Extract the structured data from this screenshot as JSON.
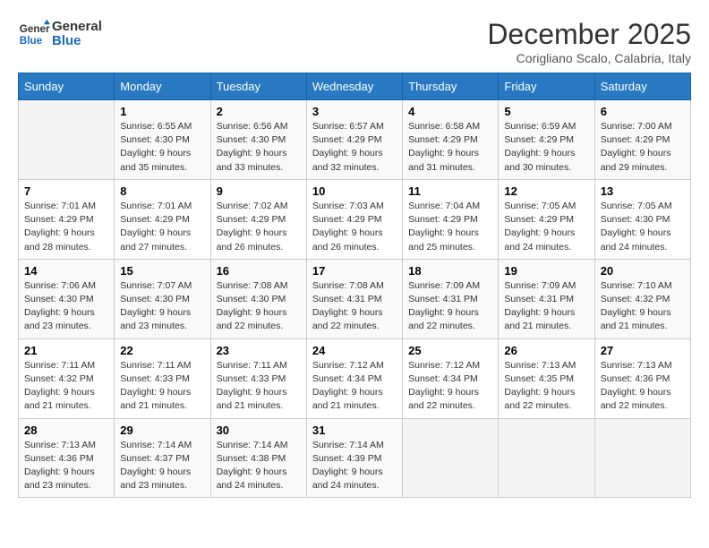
{
  "logo": {
    "line1": "General",
    "line2": "Blue"
  },
  "title": "December 2025",
  "subtitle": "Corigliano Scalo, Calabria, Italy",
  "weekdays": [
    "Sunday",
    "Monday",
    "Tuesday",
    "Wednesday",
    "Thursday",
    "Friday",
    "Saturday"
  ],
  "weeks": [
    [
      {
        "day": "",
        "info": ""
      },
      {
        "day": "1",
        "info": "Sunrise: 6:55 AM\nSunset: 4:30 PM\nDaylight: 9 hours\nand 35 minutes."
      },
      {
        "day": "2",
        "info": "Sunrise: 6:56 AM\nSunset: 4:30 PM\nDaylight: 9 hours\nand 33 minutes."
      },
      {
        "day": "3",
        "info": "Sunrise: 6:57 AM\nSunset: 4:29 PM\nDaylight: 9 hours\nand 32 minutes."
      },
      {
        "day": "4",
        "info": "Sunrise: 6:58 AM\nSunset: 4:29 PM\nDaylight: 9 hours\nand 31 minutes."
      },
      {
        "day": "5",
        "info": "Sunrise: 6:59 AM\nSunset: 4:29 PM\nDaylight: 9 hours\nand 30 minutes."
      },
      {
        "day": "6",
        "info": "Sunrise: 7:00 AM\nSunset: 4:29 PM\nDaylight: 9 hours\nand 29 minutes."
      }
    ],
    [
      {
        "day": "7",
        "info": "Sunrise: 7:01 AM\nSunset: 4:29 PM\nDaylight: 9 hours\nand 28 minutes."
      },
      {
        "day": "8",
        "info": "Sunrise: 7:01 AM\nSunset: 4:29 PM\nDaylight: 9 hours\nand 27 minutes."
      },
      {
        "day": "9",
        "info": "Sunrise: 7:02 AM\nSunset: 4:29 PM\nDaylight: 9 hours\nand 26 minutes."
      },
      {
        "day": "10",
        "info": "Sunrise: 7:03 AM\nSunset: 4:29 PM\nDaylight: 9 hours\nand 26 minutes."
      },
      {
        "day": "11",
        "info": "Sunrise: 7:04 AM\nSunset: 4:29 PM\nDaylight: 9 hours\nand 25 minutes."
      },
      {
        "day": "12",
        "info": "Sunrise: 7:05 AM\nSunset: 4:29 PM\nDaylight: 9 hours\nand 24 minutes."
      },
      {
        "day": "13",
        "info": "Sunrise: 7:05 AM\nSunset: 4:30 PM\nDaylight: 9 hours\nand 24 minutes."
      }
    ],
    [
      {
        "day": "14",
        "info": "Sunrise: 7:06 AM\nSunset: 4:30 PM\nDaylight: 9 hours\nand 23 minutes."
      },
      {
        "day": "15",
        "info": "Sunrise: 7:07 AM\nSunset: 4:30 PM\nDaylight: 9 hours\nand 23 minutes."
      },
      {
        "day": "16",
        "info": "Sunrise: 7:08 AM\nSunset: 4:30 PM\nDaylight: 9 hours\nand 22 minutes."
      },
      {
        "day": "17",
        "info": "Sunrise: 7:08 AM\nSunset: 4:31 PM\nDaylight: 9 hours\nand 22 minutes."
      },
      {
        "day": "18",
        "info": "Sunrise: 7:09 AM\nSunset: 4:31 PM\nDaylight: 9 hours\nand 22 minutes."
      },
      {
        "day": "19",
        "info": "Sunrise: 7:09 AM\nSunset: 4:31 PM\nDaylight: 9 hours\nand 21 minutes."
      },
      {
        "day": "20",
        "info": "Sunrise: 7:10 AM\nSunset: 4:32 PM\nDaylight: 9 hours\nand 21 minutes."
      }
    ],
    [
      {
        "day": "21",
        "info": "Sunrise: 7:11 AM\nSunset: 4:32 PM\nDaylight: 9 hours\nand 21 minutes."
      },
      {
        "day": "22",
        "info": "Sunrise: 7:11 AM\nSunset: 4:33 PM\nDaylight: 9 hours\nand 21 minutes."
      },
      {
        "day": "23",
        "info": "Sunrise: 7:11 AM\nSunset: 4:33 PM\nDaylight: 9 hours\nand 21 minutes."
      },
      {
        "day": "24",
        "info": "Sunrise: 7:12 AM\nSunset: 4:34 PM\nDaylight: 9 hours\nand 21 minutes."
      },
      {
        "day": "25",
        "info": "Sunrise: 7:12 AM\nSunset: 4:34 PM\nDaylight: 9 hours\nand 22 minutes."
      },
      {
        "day": "26",
        "info": "Sunrise: 7:13 AM\nSunset: 4:35 PM\nDaylight: 9 hours\nand 22 minutes."
      },
      {
        "day": "27",
        "info": "Sunrise: 7:13 AM\nSunset: 4:36 PM\nDaylight: 9 hours\nand 22 minutes."
      }
    ],
    [
      {
        "day": "28",
        "info": "Sunrise: 7:13 AM\nSunset: 4:36 PM\nDaylight: 9 hours\nand 23 minutes."
      },
      {
        "day": "29",
        "info": "Sunrise: 7:14 AM\nSunset: 4:37 PM\nDaylight: 9 hours\nand 23 minutes."
      },
      {
        "day": "30",
        "info": "Sunrise: 7:14 AM\nSunset: 4:38 PM\nDaylight: 9 hours\nand 24 minutes."
      },
      {
        "day": "31",
        "info": "Sunrise: 7:14 AM\nSunset: 4:39 PM\nDaylight: 9 hours\nand 24 minutes."
      },
      {
        "day": "",
        "info": ""
      },
      {
        "day": "",
        "info": ""
      },
      {
        "day": "",
        "info": ""
      }
    ]
  ]
}
